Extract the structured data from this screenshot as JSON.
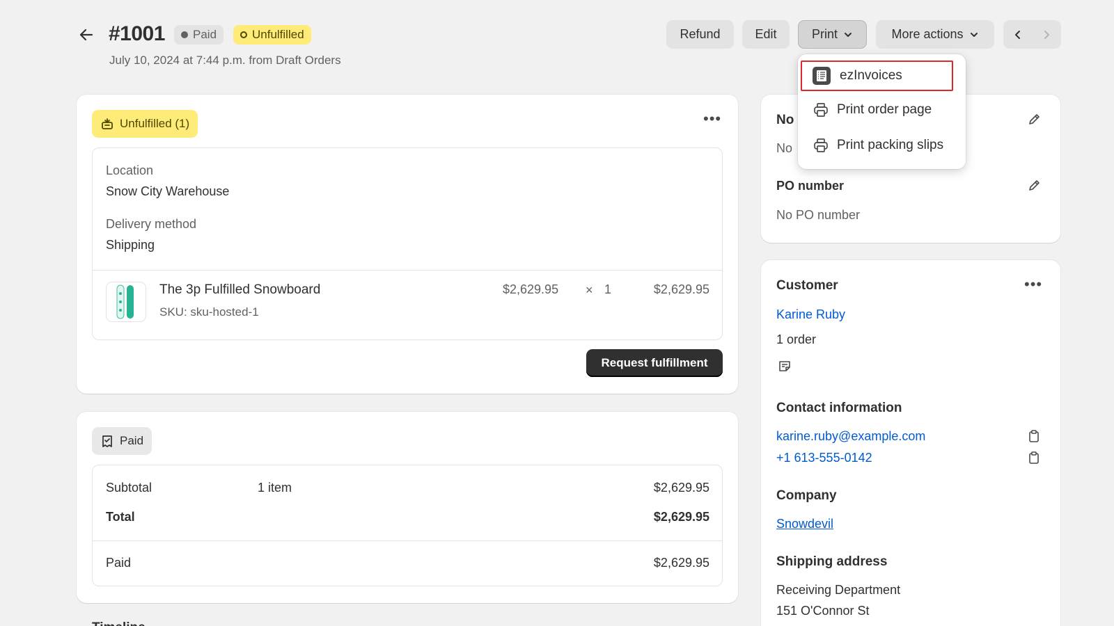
{
  "header": {
    "order_number": "#1001",
    "badge_paid": "Paid",
    "badge_unfulfilled": "Unfulfilled",
    "subtitle": "July 10, 2024 at 7:44 p.m. from Draft Orders",
    "buttons": {
      "refund": "Refund",
      "edit": "Edit",
      "print": "Print",
      "more_actions": "More actions"
    }
  },
  "print_menu": {
    "items": [
      {
        "label": "ezInvoices",
        "icon": "invoice-app-icon"
      },
      {
        "label": "Print order page",
        "icon": "printer-icon"
      },
      {
        "label": "Print packing slips",
        "icon": "printer-icon"
      }
    ]
  },
  "fulfillment": {
    "status_pill": "Unfulfilled (1)",
    "location_label": "Location",
    "location_value": "Snow City Warehouse",
    "delivery_label": "Delivery method",
    "delivery_value": "Shipping",
    "item": {
      "name": "The 3p Fulfilled Snowboard",
      "sku": "SKU: sku-hosted-1",
      "unit_price": "$2,629.95",
      "times": "×",
      "quantity": "1",
      "line_total": "$2,629.95"
    },
    "request_button": "Request fulfillment"
  },
  "payment": {
    "status_pill": "Paid",
    "subtotal_label": "Subtotal",
    "subtotal_items": "1 item",
    "subtotal_value": "$2,629.95",
    "total_label": "Total",
    "total_value": "$2,629.95",
    "paid_label": "Paid",
    "paid_value": "$2,629.95",
    "timeline_partial": "Timeline"
  },
  "notes": {
    "title_partial": "No",
    "value_partial": "No",
    "po_title": "PO number",
    "po_value": "No PO number"
  },
  "customer": {
    "title": "Customer",
    "name": "Karine Ruby",
    "orders": "1 order",
    "contact_title": "Contact information",
    "email": "karine.ruby@example.com",
    "phone": "+1 613-555-0142",
    "company_title": "Company",
    "company": "Snowdevil",
    "shipping_title": "Shipping address",
    "address_line1": "Receiving Department",
    "address_line2": "151 O'Connor St"
  },
  "colors": {
    "accent_link": "#005bd3",
    "unfulfilled_bg": "#ffeb78",
    "highlight_border": "#e0262b",
    "primary_button": "#303030"
  }
}
